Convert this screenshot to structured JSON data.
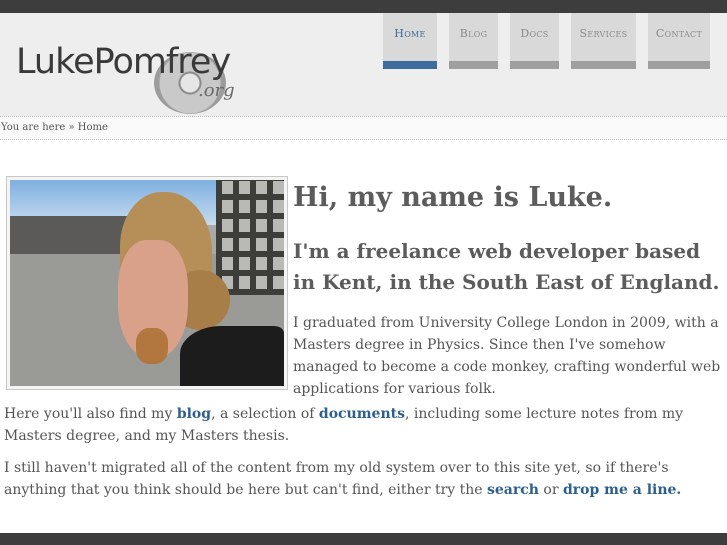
{
  "logo": {
    "main": "LukePomfrey",
    "sub": ".org"
  },
  "nav": [
    {
      "label": "Home",
      "active": true
    },
    {
      "label": "Blog",
      "active": false
    },
    {
      "label": "Docs",
      "active": false
    },
    {
      "label": "Services",
      "active": false
    },
    {
      "label": "Contact",
      "active": false
    }
  ],
  "breadcrumb": "You are here » Home",
  "main": {
    "heading": "Hi, my name is Luke.",
    "subheading": "I'm a freelance web developer based in Kent, in the South East of England.",
    "intro": "I graduated from University College London in 2009, with a Masters degree in Physics. Since then I've somehow managed to become a code monkey, crafting wonderful web applications for various folk.",
    "para2": {
      "t1": "Here you'll also find my ",
      "link1": "blog",
      "t2": ", a selection of ",
      "link2": "documents",
      "t3": ", including some lecture notes from my Masters degree, and my Masters thesis."
    },
    "para3": {
      "t1": "I still haven't migrated all of the content from my old system over to this site yet, so if there's anything that you think should be here but can't find, either try the ",
      "link1": "search",
      "t2": " or ",
      "link2": "drop me a line."
    }
  },
  "colors": {
    "accent": "#3e6c9c",
    "link": "#2d5f8e",
    "bar": "#3d3d3d"
  }
}
